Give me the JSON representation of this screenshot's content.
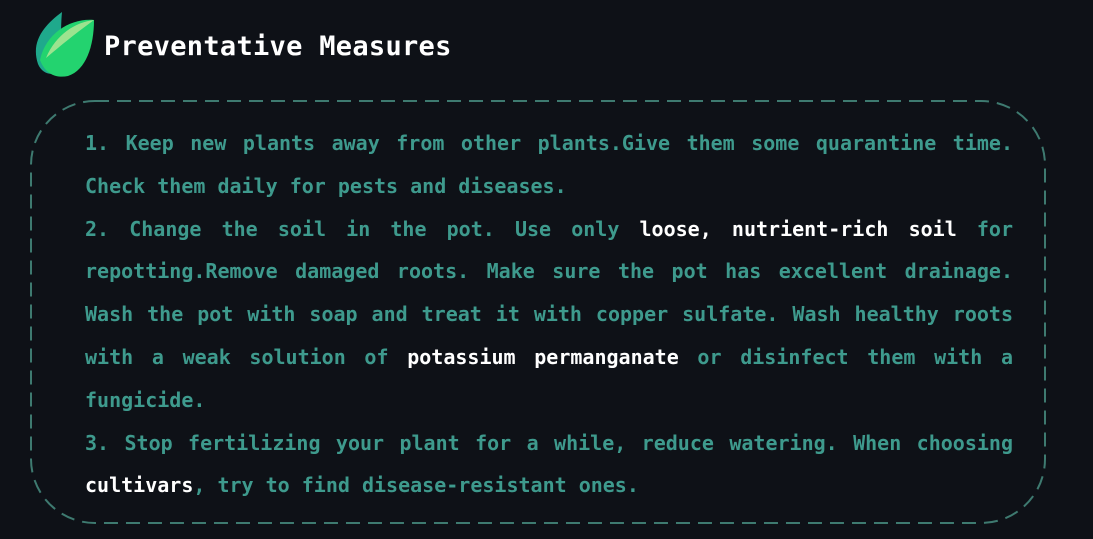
{
  "header": {
    "title": "Preventative Measures",
    "icon": "leaf-icon",
    "icon_colors": [
      "#1fa98c",
      "#9ce38f",
      "#23d36f"
    ]
  },
  "colors": {
    "background": "#0e1117",
    "text": "#3e9a8d",
    "highlight": "#ffffff",
    "border": "#3e7a70"
  },
  "items": [
    {
      "pre": "1. Keep new plants away from other plants.Give them some quarantine time. Check them daily for pests and diseases.",
      "hl1": "",
      "mid": "",
      "hl2": "",
      "post": ""
    },
    {
      "pre": "2. Change the soil in the pot. Use only ",
      "hl1": "loose, nutrient-rich soil",
      "mid": " for repotting.Remove damaged roots. Make sure the pot has excellent drainage. Wash the pot with soap and treat it with copper sulfate. Wash healthy roots with a weak solution of ",
      "hl2": "potassium permanganate",
      "post": " or disinfect them with a fungicide."
    },
    {
      "pre": "3. Stop fertilizing your plant for a while, reduce watering. When choosing ",
      "hl1": "cultivars",
      "mid": ", try to find disease-resistant ones.",
      "hl2": "",
      "post": ""
    }
  ]
}
